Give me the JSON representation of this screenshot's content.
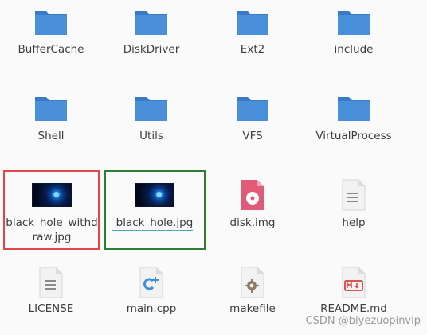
{
  "files": [
    {
      "label": "BufferCache",
      "icon": "folder-icon"
    },
    {
      "label": "DiskDriver",
      "icon": "folder-icon"
    },
    {
      "label": "Ext2",
      "icon": "folder-icon"
    },
    {
      "label": "include",
      "icon": "folder-icon"
    },
    {
      "label": "Shell",
      "icon": "folder-icon"
    },
    {
      "label": "Utils",
      "icon": "folder-icon"
    },
    {
      "label": "VFS",
      "icon": "folder-icon"
    },
    {
      "label": "VirtualProcess",
      "icon": "folder-icon"
    },
    {
      "label": "black_hole_withdraw.jpg",
      "icon": "image-thumbnail"
    },
    {
      "label": "black_hole.jpg",
      "icon": "image-thumbnail"
    },
    {
      "label": "disk.img",
      "icon": "disk-image-icon"
    },
    {
      "label": "help",
      "icon": "text-file-icon"
    },
    {
      "label": "LICENSE",
      "icon": "text-file-icon"
    },
    {
      "label": "main.cpp",
      "icon": "cpp-file-icon"
    },
    {
      "label": "makefile",
      "icon": "makefile-icon"
    },
    {
      "label": "README.md",
      "icon": "markdown-file-icon"
    }
  ],
  "watermark": "CSDN @biyezuopinvip",
  "colors": {
    "folder": "#4a8fd9",
    "folder_tab": "#3a7bc8",
    "red_box": "#e04848",
    "green_box": "#2d7d32",
    "cpp_accent": "#3a8fd9",
    "md_accent": "#d9534f",
    "disk_accent": "#e05a7a"
  }
}
